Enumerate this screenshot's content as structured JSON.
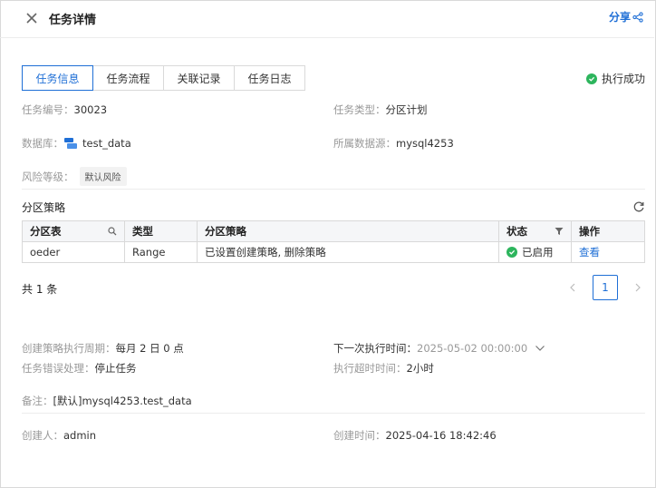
{
  "header": {
    "title": "任务详情",
    "share_label": "分享"
  },
  "tabs": [
    {
      "label": "任务信息",
      "active": true
    },
    {
      "label": "任务流程",
      "active": false
    },
    {
      "label": "关联记录",
      "active": false
    },
    {
      "label": "任务日志",
      "active": false
    }
  ],
  "status": {
    "label": "执行成功",
    "color": "#2db55d"
  },
  "info": {
    "task_id_label": "任务编号：",
    "task_id": "30023",
    "task_type_label": "任务类型：",
    "task_type": "分区计划",
    "database_label": "数据库：",
    "database": "test_data",
    "datasource_label": "所属数据源：",
    "datasource": "mysql4253",
    "risk_label": "风险等级：",
    "risk": "默认风险"
  },
  "strategy": {
    "section_title": "分区策略",
    "columns": [
      "分区表",
      "类型",
      "分区策略",
      "状态",
      "操作"
    ],
    "rows": [
      {
        "table": "oeder",
        "type": "Range",
        "policy": "已设置创建策略, 删除策略",
        "status": "已启用",
        "action": "查看"
      }
    ],
    "total": "共 1 条",
    "page": "1"
  },
  "details": {
    "cycle_label": "创建策略执行周期：",
    "cycle": "每月 2 日 0 点",
    "next_label": "下一次执行时间：",
    "next": "2025-05-02 00:00:00",
    "error_label": "任务错误处理：",
    "error": "停止任务",
    "timeout_label": "执行超时时间：",
    "timeout": "2小时",
    "remark_label": "备注：",
    "remark": "[默认]mysql4253.test_data",
    "creator_label": "创建人：",
    "creator": "admin",
    "created_label": "创建时间：",
    "created": "2025-04-16 18:42:46"
  },
  "colors": {
    "accent": "#1f6fd6",
    "success": "#2db55d"
  }
}
